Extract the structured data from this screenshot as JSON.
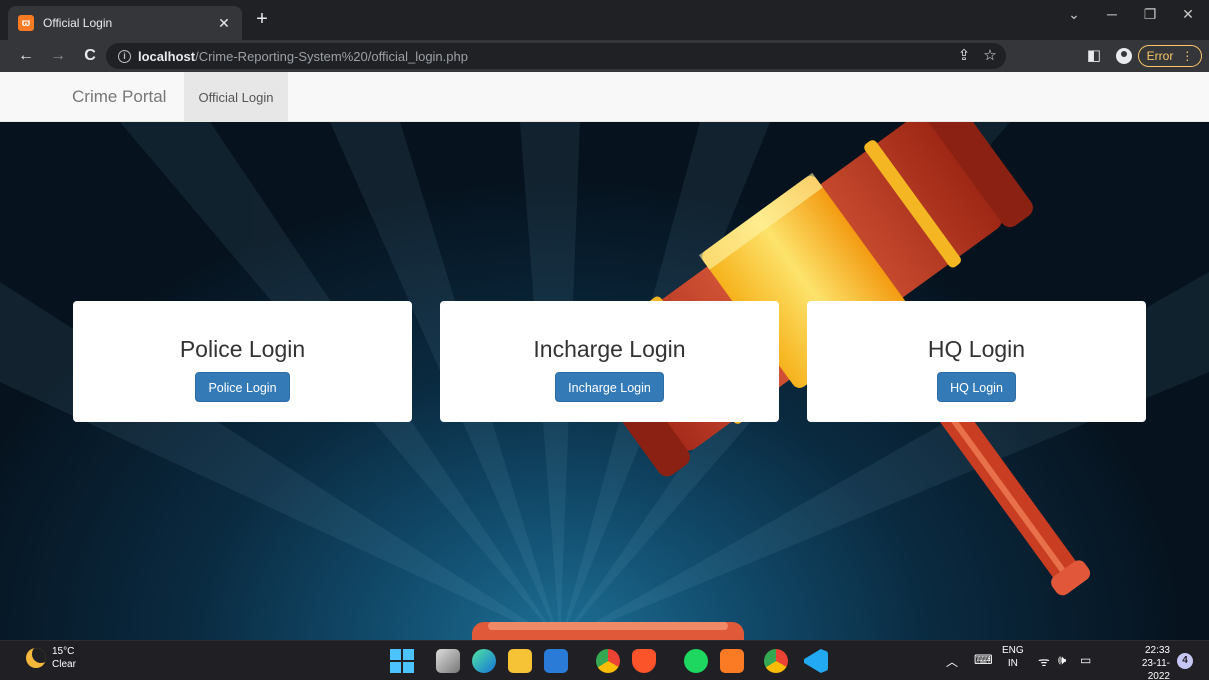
{
  "browser": {
    "tab_title": "Official Login",
    "tab_favicon_text": "ϖ",
    "url_host": "localhost",
    "url_path": "/Crime-Reporting-System%20/official_login.php",
    "error_label": "Error"
  },
  "navbar": {
    "brand": "Crime Portal",
    "active_item": "Official Login"
  },
  "cards": [
    {
      "title": "Police Login",
      "button": "Police Login"
    },
    {
      "title": "Incharge Login",
      "button": "Incharge Login"
    },
    {
      "title": "HQ Login",
      "button": "HQ Login"
    }
  ],
  "taskbar": {
    "temperature": "15°C",
    "condition": "Clear",
    "language": "ENG",
    "region": "IN",
    "time": "22:33",
    "date": "23-11-2022",
    "notification_count": "4"
  },
  "colors": {
    "primary_button": "#337ab7",
    "error_accent": "#f9c76a"
  }
}
